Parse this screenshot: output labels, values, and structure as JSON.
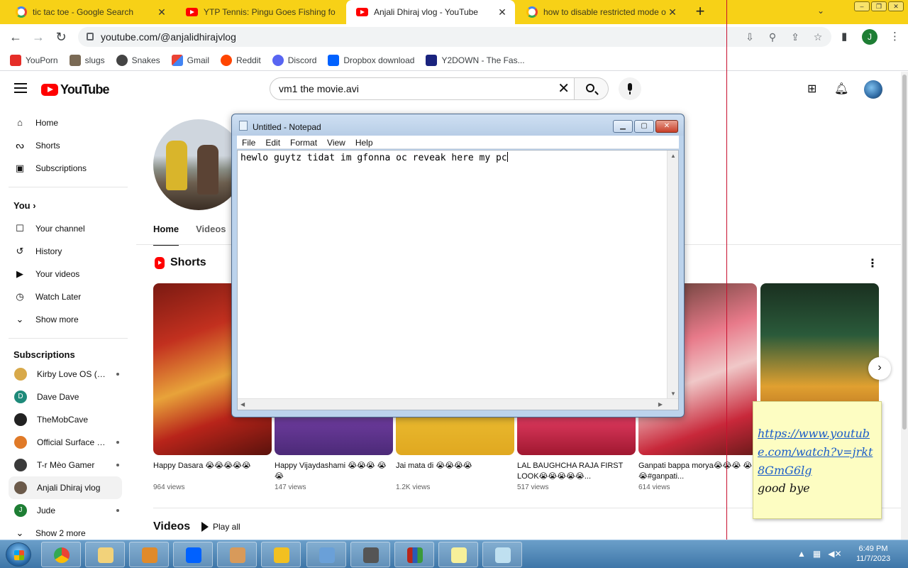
{
  "browser": {
    "tabs": [
      {
        "title": "tic tac toe - Google Search",
        "favicon": "google-icon",
        "active": false
      },
      {
        "title": "YTP Tennis: Pingu Goes Fishing fo",
        "favicon": "youtube-icon",
        "active": false
      },
      {
        "title": "Anjali Dhiraj vlog - YouTube",
        "favicon": "youtube-icon",
        "active": true
      },
      {
        "title": "how to disable restricted mode o",
        "favicon": "google-icon",
        "active": false
      }
    ],
    "new_tab": "+",
    "url": "youtube.com/@anjalidhirajvlog",
    "profile_initial": "J",
    "tabstrip_color": "#f7d117"
  },
  "bookmarks": [
    {
      "label": "YouPorn",
      "color": "#e52d27"
    },
    {
      "label": "slugs",
      "color": "#7a6a55"
    },
    {
      "label": "Snakes",
      "color": "#444444"
    },
    {
      "label": "Gmail",
      "color": "#ea4335"
    },
    {
      "label": "Reddit",
      "color": "#ff4500"
    },
    {
      "label": "Discord",
      "color": "#5865f2"
    },
    {
      "label": "Dropbox download",
      "color": "#0061ff"
    },
    {
      "label": "Y2DOWN - The Fas...",
      "color": "#1a237e"
    }
  ],
  "youtube": {
    "logo_text": "YouTube",
    "search_value": "vm1 the movie.avi",
    "sidebar": {
      "main": [
        {
          "label": "Home",
          "icon": "home-icon"
        },
        {
          "label": "Shorts",
          "icon": "shorts-icon"
        },
        {
          "label": "Subscriptions",
          "icon": "subscriptions-icon"
        }
      ],
      "you_heading": "You",
      "you_items": [
        {
          "label": "Your channel",
          "icon": "channel-icon"
        },
        {
          "label": "History",
          "icon": "history-icon"
        },
        {
          "label": "Your videos",
          "icon": "video-icon"
        },
        {
          "label": "Watch Later",
          "icon": "clock-icon"
        },
        {
          "label": "Show more",
          "icon": "chevron-down-icon"
        }
      ],
      "subscriptions_heading": "Subscriptions",
      "subscriptions": [
        {
          "name": "Kirby Love OS (M...",
          "color": "#d8a94a",
          "initial": "",
          "new": true
        },
        {
          "name": "Dave Dave",
          "color": "#1e8a7a",
          "initial": "D",
          "new": false
        },
        {
          "name": "TheMobCave",
          "color": "#222222",
          "initial": "",
          "new": false
        },
        {
          "name": "Official Surface R...",
          "color": "#e07a28",
          "initial": "",
          "new": true
        },
        {
          "name": "T-r Mèo Gamer",
          "color": "#3a3a3a",
          "initial": "",
          "new": true
        },
        {
          "name": "Anjali Dhiraj vlog",
          "color": "#6b5a4a",
          "initial": "",
          "new": false
        },
        {
          "name": "Jude",
          "color": "#1e7e34",
          "initial": "J",
          "new": true
        }
      ],
      "show_more_subs": "Show 2 more"
    },
    "channel": {
      "tabs": [
        "Home",
        "Videos"
      ],
      "shorts_heading": "Shorts",
      "shorts": [
        {
          "title": "Happy Dasara 😭😭😭😭😭",
          "views": "964 views"
        },
        {
          "title": "Happy Vijaydashami 😭😭😭 😭😭",
          "views": "147 views"
        },
        {
          "title": "Jai mata di 😭😭😭😭",
          "views": "1.2K views"
        },
        {
          "title": "LAL BAUGHCHA RAJA FIRST LOOK😭😭😭😭😭...",
          "views": "517 views"
        },
        {
          "title": "Ganpati bappa morya😭😭😭 😭😭#ganpati...",
          "views": "614 views"
        },
        {
          "title": "",
          "views": ""
        }
      ],
      "videos_heading": "Videos",
      "play_all": "Play all"
    }
  },
  "notepad": {
    "title": "Untitled - Notepad",
    "menus": [
      "File",
      "Edit",
      "Format",
      "View",
      "Help"
    ],
    "text": "hewlo guytz tidat im gfonna oc reveak here my pc"
  },
  "sticky_note": {
    "link": "https://www.youtube.com/watch?v=jrkt8GmG6lg",
    "text": "good bye"
  },
  "taskbar": {
    "apps": [
      "chrome-icon",
      "file-explorer-icon",
      "media-player-icon",
      "dropbox-icon",
      "tool-icon",
      "pencil-icon",
      "photo-viewer-icon",
      "movie-maker-icon",
      "winrar-icon",
      "sticky-notes-icon",
      "notepad-icon"
    ],
    "time": "6:49 PM",
    "date": "11/7/2023"
  }
}
